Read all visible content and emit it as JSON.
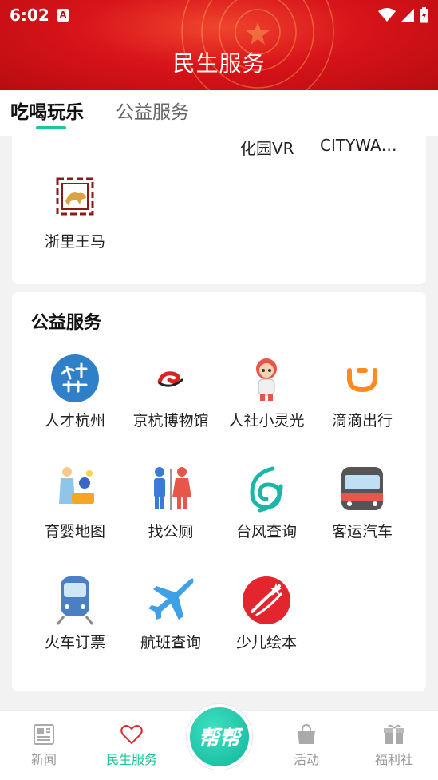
{
  "status": {
    "time": "6:02",
    "notif_badge": "A"
  },
  "header": {
    "title": "民生服务"
  },
  "tabs": [
    {
      "label": "吃喝玩乐",
      "active": true
    },
    {
      "label": "公益服务",
      "active": false
    }
  ],
  "card1": {
    "partial_labels": [
      "化园VR",
      "CITYWA…"
    ],
    "items": [
      {
        "label": "浙里王马",
        "icon": "zheli-wangma-icon"
      }
    ]
  },
  "card2": {
    "title": "公益服务",
    "items": [
      {
        "label": "人才杭州",
        "icon": "talent-hangzhou-icon"
      },
      {
        "label": "京杭博物馆",
        "icon": "museum-icon"
      },
      {
        "label": "人社小灵光",
        "icon": "mascot-icon"
      },
      {
        "label": "滴滴出行",
        "icon": "didi-icon"
      },
      {
        "label": "育婴地图",
        "icon": "nursing-map-icon"
      },
      {
        "label": "找公厕",
        "icon": "toilet-icon"
      },
      {
        "label": "台风查询",
        "icon": "typhoon-icon"
      },
      {
        "label": "客运汽车",
        "icon": "bus-icon"
      },
      {
        "label": "火车订票",
        "icon": "train-icon"
      },
      {
        "label": "航班查询",
        "icon": "plane-icon"
      },
      {
        "label": "少儿绘本",
        "icon": "picture-book-icon"
      }
    ]
  },
  "bottom_nav": {
    "items": [
      {
        "label": "新闻",
        "icon": "newspaper-icon",
        "active": false
      },
      {
        "label": "民生服务",
        "icon": "heart-icon",
        "active": true
      },
      {
        "label": "活动",
        "icon": "bag-icon",
        "active": false
      },
      {
        "label": "福利社",
        "icon": "gift-icon",
        "active": false
      }
    ],
    "center_button": "帮帮"
  },
  "colors": {
    "accent": "#1cc59a",
    "header_red": "#d8141a"
  }
}
